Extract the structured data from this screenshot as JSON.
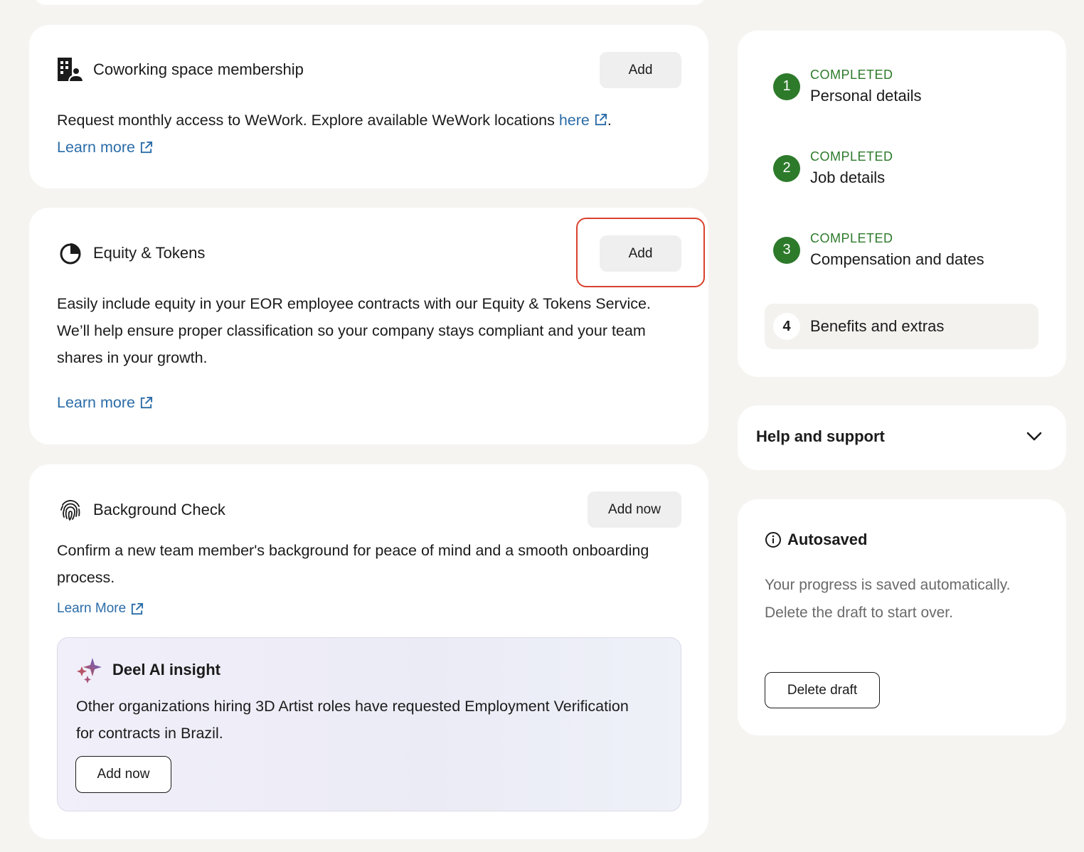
{
  "cowork": {
    "title": "Coworking space membership",
    "add_label": "Add",
    "desc_prefix": "Request monthly access to WeWork. Explore available WeWork locations ",
    "desc_link": "here",
    "desc_suffix": ".",
    "learn_more": "Learn more"
  },
  "equity": {
    "title": "Equity & Tokens",
    "add_label": "Add",
    "desc": "Easily include equity in your EOR employee contracts with our Equity & Tokens Service. We’ll help ensure proper classification so your company stays compliant and your team shares in your growth.",
    "learn_more": "Learn more"
  },
  "background": {
    "title": "Background Check",
    "add_label": "Add now",
    "desc": "Confirm a new team member's background for peace of mind and a smooth onboarding process.",
    "learn_more": "Learn More",
    "insight": {
      "title": "Deel AI insight",
      "text": "Other organizations hiring 3D Artist roles have requested Employment Verification for contracts in Brazil.",
      "button": "Add now"
    }
  },
  "steps": [
    {
      "num": "1",
      "status": "COMPLETED",
      "label": "Personal details"
    },
    {
      "num": "2",
      "status": "COMPLETED",
      "label": "Job details"
    },
    {
      "num": "3",
      "status": "COMPLETED",
      "label": "Compensation and dates"
    },
    {
      "num": "4",
      "status": "",
      "label": "Benefits and extras"
    }
  ],
  "help": {
    "title": "Help and support"
  },
  "autosave": {
    "title": "Autosaved",
    "text": "Your progress is saved automatically. Delete the draft to start over.",
    "delete_label": "Delete draft"
  },
  "colors": {
    "accent_green": "#2d7a2b",
    "link_blue": "#2b6ca8",
    "highlight_red": "#d9412e"
  }
}
